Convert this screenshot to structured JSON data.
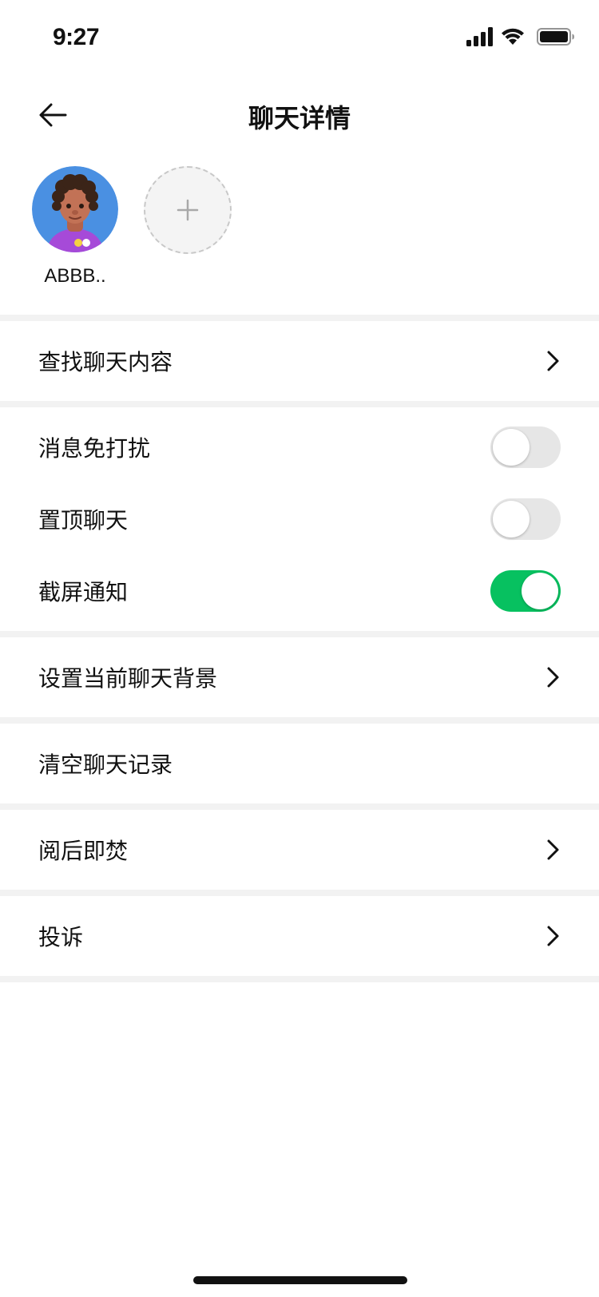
{
  "status_bar": {
    "time": "9:27"
  },
  "nav": {
    "title": "聊天详情",
    "back_icon": "arrow-left-icon"
  },
  "members": [
    {
      "name": "ABBB..",
      "avatar_bg": "#4a90e2"
    }
  ],
  "add_member_icon": "plus-icon",
  "menu": {
    "find_chat": "查找聊天内容",
    "mute": "消息免打扰",
    "pin": "置顶聊天",
    "screenshot_notify": "截屏通知",
    "set_background": "设置当前聊天背景",
    "clear_history": "清空聊天记录",
    "burn_after_read": "阅后即焚",
    "report": "投诉"
  },
  "toggles": {
    "mute": false,
    "pin": false,
    "screenshot_notify": true
  },
  "colors": {
    "accent": "#07c160",
    "separator": "#f2f2f2",
    "toggle_off": "#e6e6e6"
  }
}
